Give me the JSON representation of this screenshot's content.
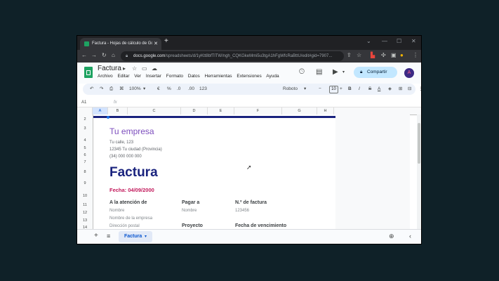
{
  "browser": {
    "tab_title": "Factura - Hojas de cálculo de Go",
    "url_domain": "docs.google.com",
    "url_rest": "/spreadsheets/d/1yKtt8bfTlTW/ngh_CQKGkeMmi5u3tgA1hFgWfcRaBttU/edit#gid=7907..."
  },
  "doc": {
    "title": "Factura",
    "menu": [
      "Archivo",
      "Editar",
      "Ver",
      "Insertar",
      "Formato",
      "Datos",
      "Herramientas",
      "Extensiones",
      "Ayuda"
    ],
    "share_label": "Compartir",
    "avatar_letter": "A"
  },
  "toolbar": {
    "zoom": "100%",
    "currency": "€",
    "percent": "%",
    "dec_less": ".0",
    "dec_more": ".00",
    "format_123": "123",
    "font": "Roboto",
    "font_size": "10",
    "bold": "B",
    "italic": "I"
  },
  "formula": {
    "cell_ref": "A1",
    "fx": "fx"
  },
  "columns": [
    "A",
    "B",
    "C",
    "D",
    "E",
    "F",
    "G",
    "H"
  ],
  "rows": [
    "2",
    "3",
    "4",
    "5",
    "6",
    "7",
    "8",
    "9",
    "10",
    "11",
    "12",
    "13",
    "14"
  ],
  "invoice": {
    "company": "Tu empresa",
    "street": "Tu calle, 123",
    "city": "12345 Tu ciudad (Provincia)",
    "phone": "(34) 000 000 000",
    "heading": "Factura",
    "date": "Fecha: 04/09/2000",
    "attention_label": "A la atención de",
    "attention_name": "Nombre",
    "attention_company": "Nombre de la empresa",
    "attention_address": "Dirección postal",
    "payto_label": "Pagar a",
    "payto_name": "Nombre",
    "invoice_no_label": "N.º de factura",
    "invoice_no": "123456",
    "project_label": "Proyecto",
    "due_label": "Fecha de vencimiento"
  },
  "sheet_tab": "Factura",
  "colors": {
    "primary": "#1a237e",
    "accent": "#7c4dbd",
    "date": "#c2185b",
    "share": "#c2e7ff"
  }
}
